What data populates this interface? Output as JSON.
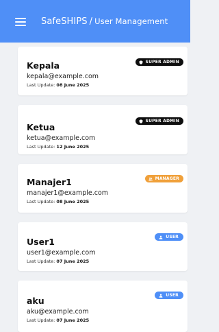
{
  "app": {
    "title": "SafeSHIPS",
    "separator": "/",
    "subtitle": "User Management"
  },
  "icons": {
    "menu": "hamburger-menu-icon",
    "super_admin": "shield-icon",
    "manager": "users-icon",
    "user": "person-icon"
  },
  "colors": {
    "appbar": "#4f8ff7",
    "background": "#eff1f4",
    "super_admin_badge": "#0f0f0f",
    "manager_badge": "#f0a03a",
    "user_badge": "#4f8ff7"
  },
  "users": [
    {
      "name": "Kepala",
      "email": "kepala@example.com",
      "update_label": "Last Update:",
      "update_date": "08 June 2025",
      "role": "SUPER ADMIN"
    },
    {
      "name": "Ketua",
      "email": "ketua@example.com",
      "update_label": "Last Update:",
      "update_date": "12 June 2025",
      "role": "SUPER ADMIN"
    },
    {
      "name": "Manajer1",
      "email": "manajer1@example.com",
      "update_label": "Last Update:",
      "update_date": "08 June 2025",
      "role": "MANAGER"
    },
    {
      "name": "User1",
      "email": "user1@example.com",
      "update_label": "Last Update:",
      "update_date": "07 June 2025",
      "role": "USER"
    },
    {
      "name": "aku",
      "email": "aku@example.com",
      "update_label": "Last Update:",
      "update_date": "07 June 2025",
      "role": "USER"
    }
  ]
}
